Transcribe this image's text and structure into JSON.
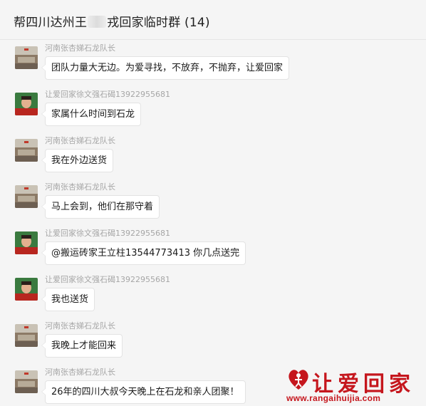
{
  "header": {
    "title_prefix": "帮四川达州王",
    "title_suffix": "戎回家临时群 (14)"
  },
  "colors": {
    "background": "#f5f5f5",
    "bubble": "#ffffff",
    "sender_text": "#a6a6a6",
    "watermark_red": "#c5161d"
  },
  "messages": [
    {
      "sender": "河南张杏娣石龙队长",
      "text": "团队力量大无边。为爱寻找，不放弃，不抛弃，让爱回家",
      "avatar": "building-avatar"
    },
    {
      "sender": "让爱回家徐文强石碣13922955681",
      "text": "家属什么时间到石龙",
      "avatar": "person-avatar"
    },
    {
      "sender": "河南张杏娣石龙队长",
      "text": "我在外边送货",
      "avatar": "building-avatar"
    },
    {
      "sender": "河南张杏娣石龙队长",
      "text": "马上会到，他们在那守着",
      "avatar": "building-avatar"
    },
    {
      "sender": "让爱回家徐文强石碣13922955681",
      "text": "@搬运砖家王立柱13544773413 你几点送完",
      "avatar": "person-avatar"
    },
    {
      "sender": "让爱回家徐文强石碣13922955681",
      "text": "我也送货",
      "avatar": "person-avatar"
    },
    {
      "sender": "河南张杏娣石龙队长",
      "text": "我晚上才能回来",
      "avatar": "building-avatar"
    },
    {
      "sender": "河南张杏娣石龙队长",
      "text": "26年的四川大叔今天晚上在石龙和亲人团聚！",
      "avatar": "building-avatar"
    }
  ],
  "watermark": {
    "text": "让爱回家",
    "url": "www.rangaihuijia.com"
  }
}
